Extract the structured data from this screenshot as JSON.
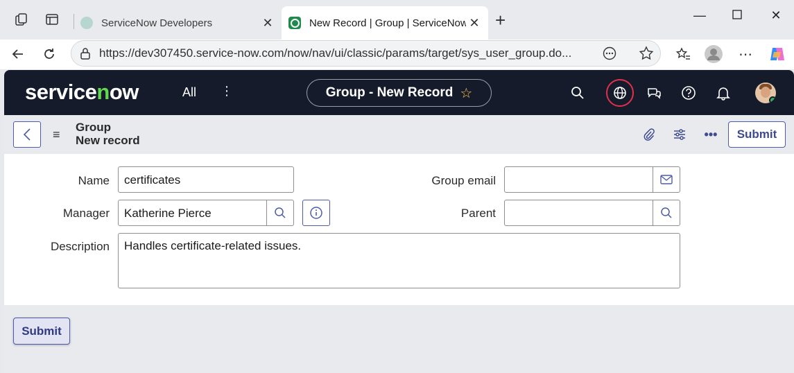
{
  "browser": {
    "tabs": [
      {
        "title": "ServiceNow Developers",
        "active": false
      },
      {
        "title": "New Record | Group | ServiceNow",
        "active": true
      }
    ],
    "url": "https://dev307450.service-now.com/now/nav/ui/classic/params/target/sys_user_group.do..."
  },
  "header": {
    "logo": "servicenow",
    "all_label": "All",
    "pill_title": "Group - New Record"
  },
  "form_header": {
    "table_label": "Group",
    "record_label": "New record",
    "submit_label": "Submit"
  },
  "form": {
    "name_label": "Name",
    "name_value": "certificates",
    "manager_label": "Manager",
    "manager_value": "Katherine Pierce",
    "description_label": "Description",
    "description_value": "Handles certificate-related issues.",
    "group_email_label": "Group email",
    "group_email_value": "",
    "parent_label": "Parent",
    "parent_value": ""
  },
  "footer": {
    "submit_label": "Submit"
  },
  "colors": {
    "header_bg": "#161b2c",
    "accent": "#4d5aa8",
    "logo_green": "#62d84e",
    "globe_ring": "#e0314b"
  }
}
